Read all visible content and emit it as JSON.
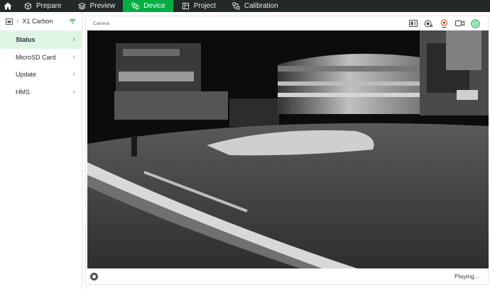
{
  "nav": {
    "tabs": [
      {
        "label": "Prepare",
        "icon": "cube-icon"
      },
      {
        "label": "Preview",
        "icon": "layers-icon"
      },
      {
        "label": "Device",
        "icon": "device-icon",
        "active": true
      },
      {
        "label": "Project",
        "icon": "project-icon"
      },
      {
        "label": "Calibration",
        "icon": "calibration-icon"
      }
    ],
    "colors": {
      "bar": "#232829",
      "active": "#00ae42"
    }
  },
  "sidebar": {
    "printer_name": "X1 Carbon",
    "items": [
      {
        "label": "Status",
        "active": true
      },
      {
        "label": "MicroSD Card"
      },
      {
        "label": "Update"
      },
      {
        "label": "HMS"
      }
    ]
  },
  "camera": {
    "title": "Camera",
    "tools": [
      "sd-card-icon",
      "recording-icon",
      "timelapse-icon",
      "video-camera-icon",
      "settings-gear-icon"
    ],
    "status": "Playing..."
  }
}
